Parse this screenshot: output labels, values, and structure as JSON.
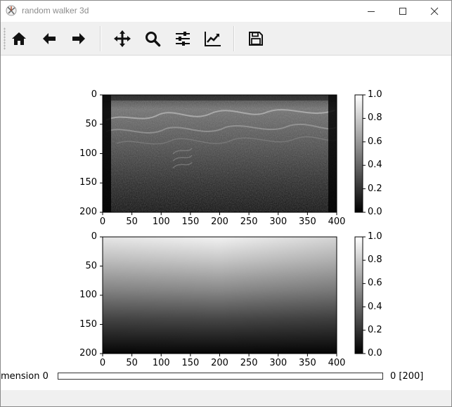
{
  "window": {
    "title": "random walker 3d",
    "controls": {
      "minimize_icon": "minimize-icon",
      "maximize_icon": "maximize-icon",
      "close_icon": "close-icon"
    }
  },
  "toolbar": {
    "buttons": [
      {
        "icon": "home-icon"
      },
      {
        "icon": "back-arrow-icon"
      },
      {
        "icon": "forward-arrow-icon"
      },
      {
        "icon": "pan-move-icon"
      },
      {
        "icon": "zoom-magnifier-icon"
      },
      {
        "icon": "configure-subplots-icon"
      },
      {
        "icon": "edit-axis-lines-icon"
      },
      {
        "icon": "save-floppy-icon"
      }
    ]
  },
  "plots": {
    "top": {
      "y_ticks": [
        "0",
        "50",
        "100",
        "150",
        "200"
      ],
      "x_ticks": [
        "0",
        "50",
        "100",
        "150",
        "200",
        "250",
        "300",
        "350",
        "400"
      ],
      "colorbar_ticks": [
        "1.0",
        "0.8",
        "0.6",
        "0.4",
        "0.2",
        "0.0"
      ]
    },
    "bottom": {
      "y_ticks": [
        "0",
        "50",
        "100",
        "150",
        "200"
      ],
      "x_ticks": [
        "0",
        "50",
        "100",
        "150",
        "200",
        "250",
        "300",
        "350",
        "400"
      ],
      "colorbar_ticks": [
        "1.0",
        "0.8",
        "0.6",
        "0.4",
        "0.2",
        "0.0"
      ]
    }
  },
  "slider": {
    "label": "mension 0",
    "value_text": "0 [200]",
    "value": 0
  }
}
